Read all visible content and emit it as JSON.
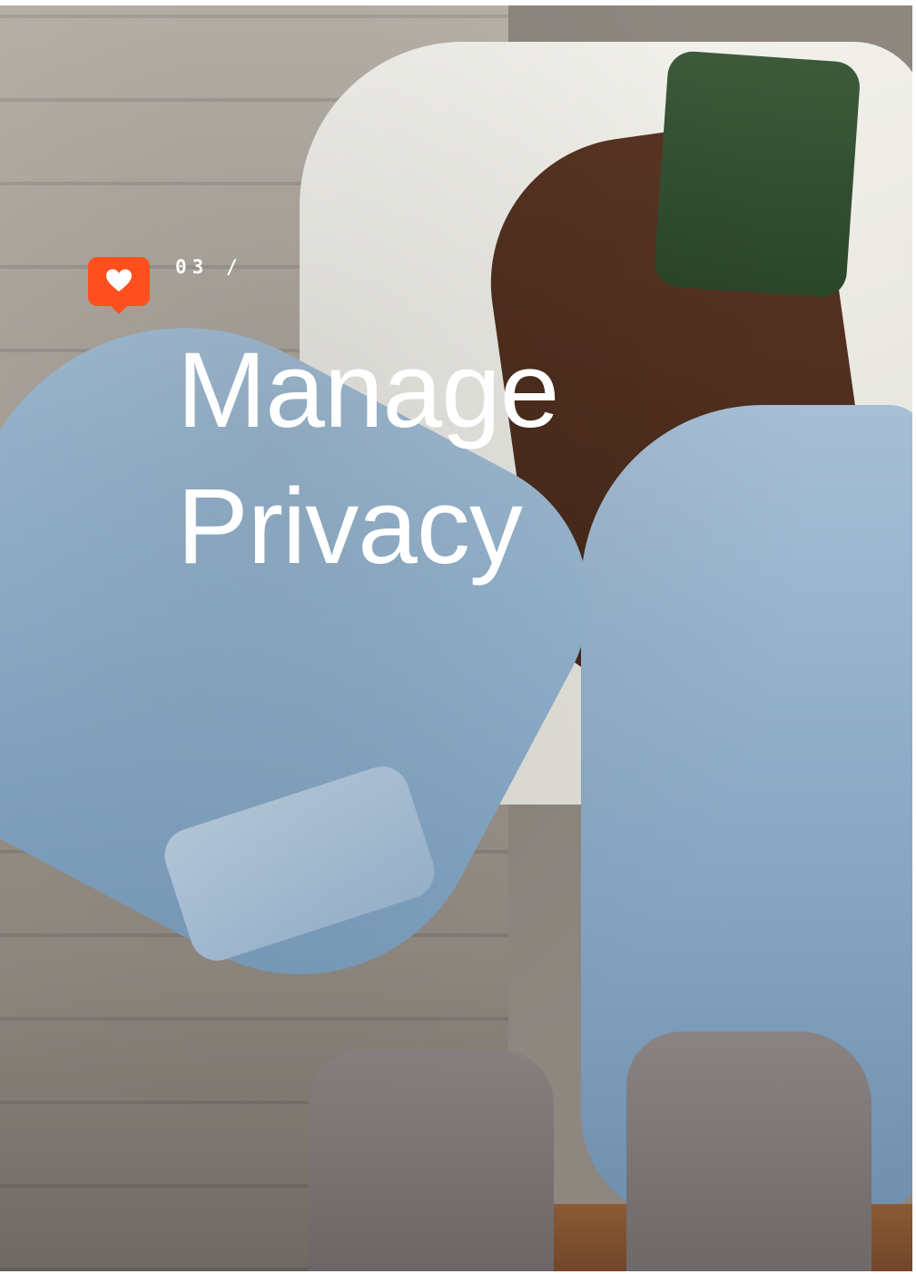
{
  "section": {
    "number": "03 /",
    "title_line1": "Manage",
    "title_line2": "Privacy"
  },
  "badge": {
    "icon": "heart-icon",
    "color": "#ff4f1f"
  },
  "photo": {
    "subject": "photo-background"
  }
}
